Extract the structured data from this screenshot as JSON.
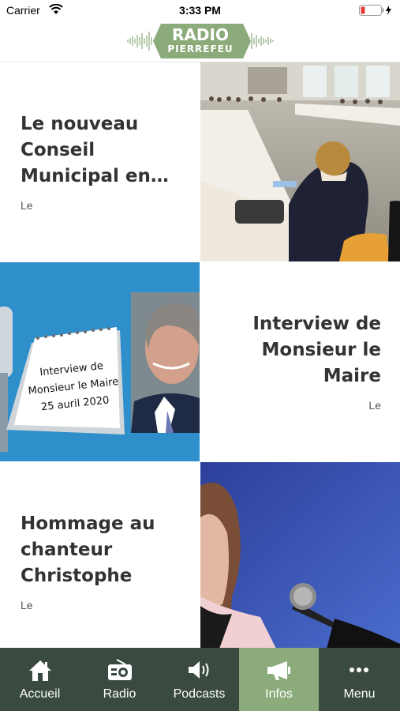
{
  "status_bar": {
    "carrier": "Carrier",
    "time": "3:33 PM"
  },
  "header": {
    "logo_line1": "RADIO",
    "logo_line2": "PIERREFEU",
    "logo_color": "#8cab7a"
  },
  "articles": [
    {
      "title": "Le nouveau Conseil Municipal en…",
      "meta": "Le",
      "image": "council-meeting-photo"
    },
    {
      "title": "Interview de Monsieur le Maire",
      "meta": "Le",
      "image": "mayor-interview-graphic",
      "image_calendar_text": [
        "Interview de",
        "Monsieur le Maire",
        "25 auril 2020"
      ]
    },
    {
      "title": "Hommage au chanteur Christophe",
      "meta": "Le",
      "image": "singer-photo"
    }
  ],
  "tabbar": {
    "tabs": [
      {
        "label": "Accueil",
        "icon": "home-icon",
        "active": false
      },
      {
        "label": "Radio",
        "icon": "radio-icon",
        "active": false
      },
      {
        "label": "Podcasts",
        "icon": "speaker-icon",
        "active": false
      },
      {
        "label": "Infos",
        "icon": "megaphone-icon",
        "active": true
      },
      {
        "label": "Menu",
        "icon": "more-icon",
        "active": false
      }
    ],
    "background": "#3a4a40",
    "active_color": "#8cab7a"
  }
}
